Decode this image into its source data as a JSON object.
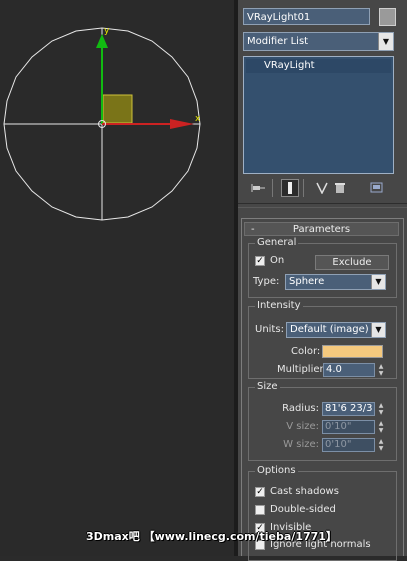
{
  "viewport": {
    "axis_y_label": "y",
    "axis_x_label": "x",
    "colors": {
      "circle": "#e8e8e8",
      "y_axis": "#11bb11",
      "x_axis": "#cc2222",
      "plane": "#7a7418"
    }
  },
  "command_panel": {
    "object_name": "VRayLight01",
    "modifier_list": "Modifier List",
    "stack_item": "VRayLight",
    "toolbar_icons": [
      "pin-stack-icon",
      "show-end-result-icon",
      "make-unique-icon",
      "remove-modifier-icon",
      "configure-modifier-sets-icon"
    ]
  },
  "parameters": {
    "title": "Parameters",
    "collapse_symbol": "-",
    "general": {
      "label": "General",
      "on_checked": true,
      "on_label": "On",
      "exclude_label": "Exclude",
      "type_label": "Type:",
      "type_value": "Sphere"
    },
    "intensity": {
      "label": "Intensity",
      "units_label": "Units:",
      "units_value": "Default (image)",
      "color_label": "Color:",
      "color_value": "#f5c97e",
      "multiplier_label": "Multiplier:",
      "multiplier_value": "4.0"
    },
    "size": {
      "label": "Size",
      "radius_label": "Radius:",
      "radius_value": "81'6 23/3",
      "v_label": "V size:",
      "v_value": "0'10\"",
      "w_label": "W size:",
      "w_value": "0'10\""
    },
    "options": {
      "label": "Options",
      "cast_shadows": "Cast shadows",
      "cast_shadows_checked": true,
      "double_sided": "Double-sided",
      "double_sided_checked": false,
      "invisible": "Invisible",
      "invisible_checked": true,
      "ignore_light_normals": "Ignore light normals"
    }
  },
  "watermark": "3Dmax吧 【www.linecg.com/tieba/1771】"
}
